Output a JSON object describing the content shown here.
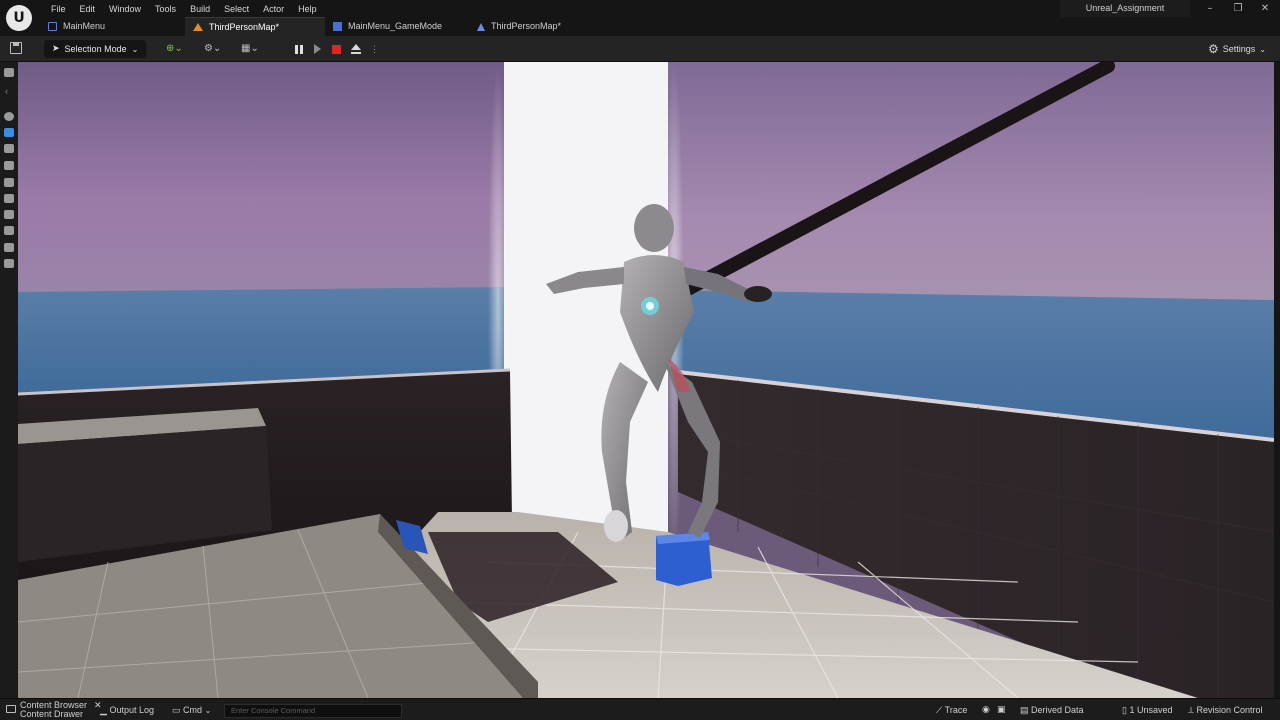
{
  "menu": [
    "File",
    "Edit",
    "Window",
    "Tools",
    "Build",
    "Select",
    "Actor",
    "Help"
  ],
  "project_name": "Unreal_Assignment",
  "tabs": [
    {
      "label": "MainMenu",
      "icon": "level-icon"
    },
    {
      "label": "ThirdPersonMap*",
      "icon": "map-icon"
    },
    {
      "label": "MainMenu_GameMode",
      "icon": "blueprint-icon"
    },
    {
      "label": "ThirdPersonMap*",
      "icon": "map-icon"
    }
  ],
  "toolbar": {
    "selection_mode": "Selection Mode",
    "settings": "Settings"
  },
  "statusbar": {
    "content_browser": "Content Browser",
    "content_drawer": "Content Drawer",
    "output_log": "Output Log",
    "cmd": "Cmd",
    "console_placeholder": "Enter Console Command",
    "trace": "Trace",
    "derived_data": "Derived Data",
    "unsaved": "1 Unsaved",
    "revision_control": "Revision Control"
  },
  "colors": {
    "accent_blue": "#3a8de0",
    "stop_red": "#e02424",
    "sky_purple": "#8a6f9e",
    "sea_blue": "#456f9e"
  }
}
